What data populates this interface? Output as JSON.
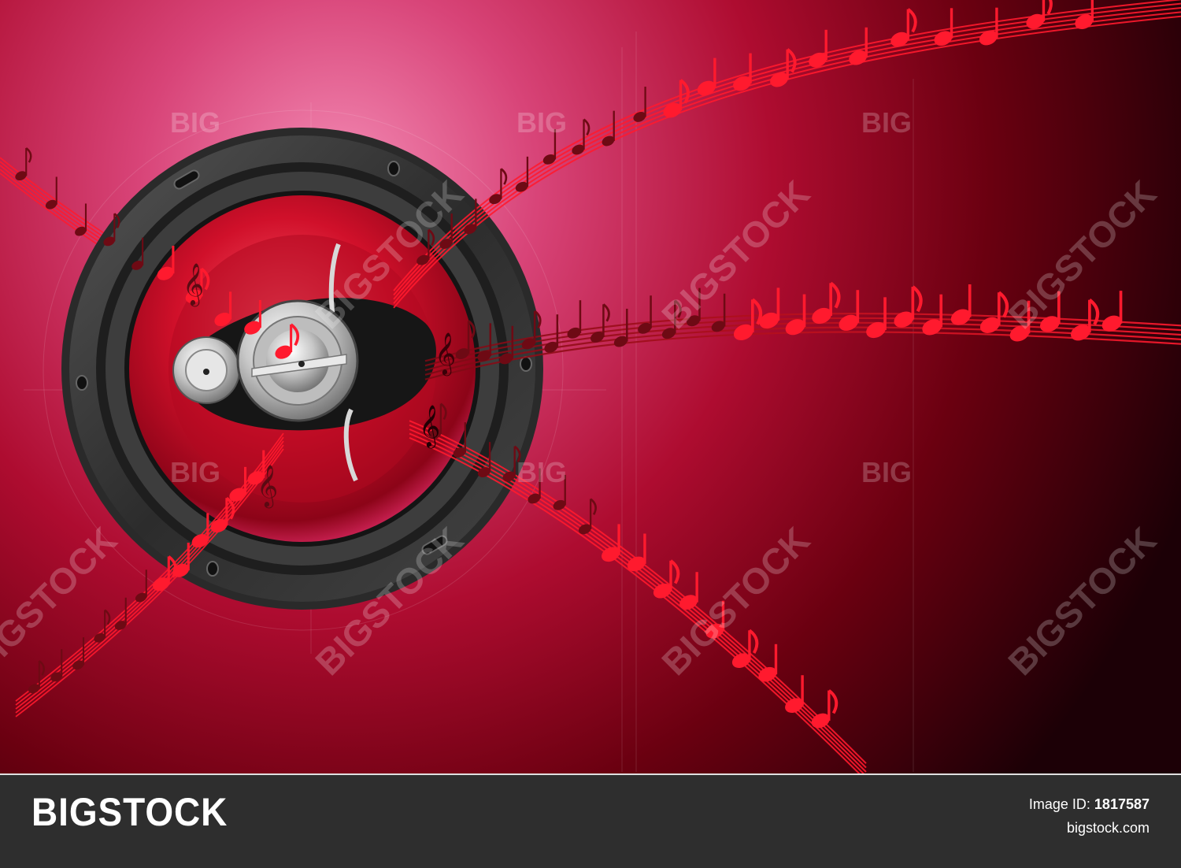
{
  "watermark": {
    "short": "BIG",
    "long": "BIGSTOCK"
  },
  "footer": {
    "brand": "BIGSTOCK",
    "image_id_label": "Image ID:",
    "image_id": "1817587",
    "site": "bigstock.com"
  },
  "colors": {
    "background_glow": "#f07aa8",
    "background_mid": "#b8103a",
    "background_dark": "#200006",
    "note_red": "#ff1a2e",
    "note_dark": "#6e0a14",
    "speaker_rim": "#3a3a3a",
    "cone": "#c40f24",
    "footer_bg": "#2e2e2e"
  },
  "icons": [
    "speaker-icon",
    "music-note-icon",
    "treble-clef-icon"
  ]
}
